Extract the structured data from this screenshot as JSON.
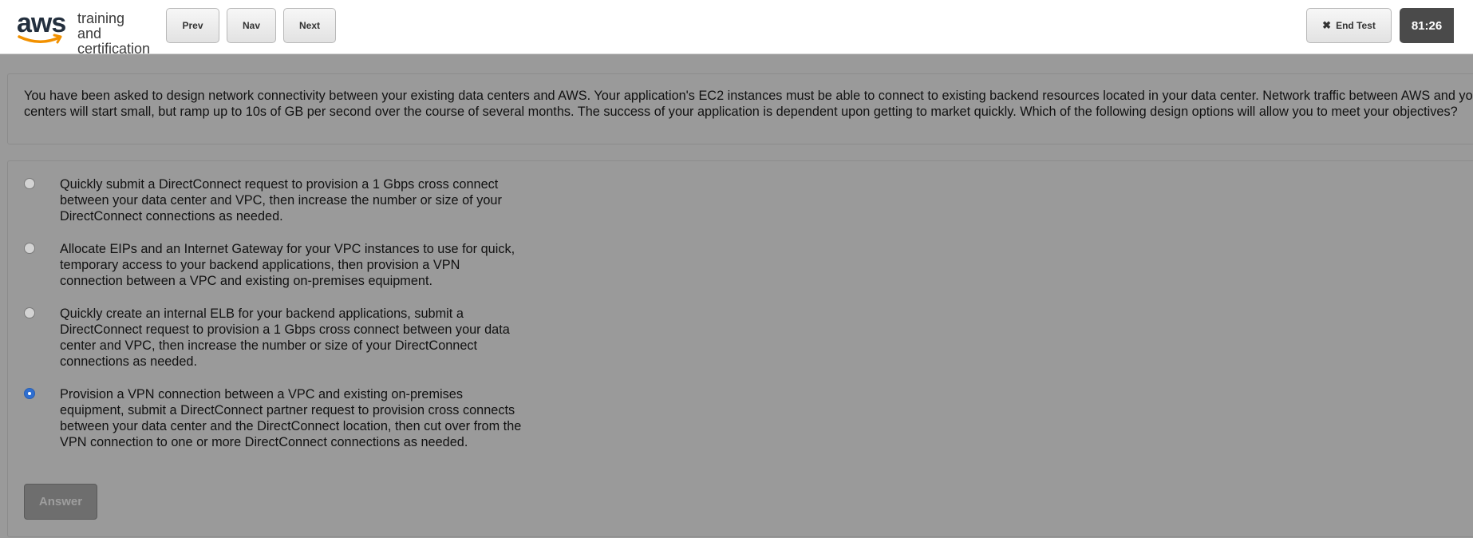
{
  "header": {
    "logo": {
      "brand": "aws",
      "subtitle_line1": "training and",
      "subtitle_line2": "certification"
    },
    "prev_label": "Prev",
    "nav_label": "Nav",
    "next_label": "Next",
    "end_test_label": "End Test",
    "timer": "81:26"
  },
  "question": {
    "text": "You have been asked to design network connectivity between your existing data centers and AWS. Your application's EC2 instances must be able to connect to existing backend resources located in your data center. Network traffic between AWS and your data centers will start small, but ramp up to 10s of GB per second over the course of several months. The success of your application is dependent upon getting to market quickly. Which of the following design options will allow you to meet your objectives?"
  },
  "options": [
    {
      "text": "Quickly submit a DirectConnect request to provision a 1 Gbps cross connect between your data center and VPC, then increase the number or size of your DirectConnect connections as needed.",
      "selected": false
    },
    {
      "text": "Allocate EIPs and an Internet Gateway for your VPC instances to use for quick, temporary access to your backend applications, then provision a VPN connection between a VPC and existing on-premises equipment.",
      "selected": false
    },
    {
      "text": "Quickly create an internal ELB for your backend applications, submit a DirectConnect request to provision a 1 Gbps cross connect between your data center and VPC, then increase the number or size of your DirectConnect connections as needed.",
      "selected": false
    },
    {
      "text": "Provision a VPN connection between a VPC and existing on-premises equipment, submit a DirectConnect partner request to provision cross connects between your data center and the DirectConnect location, then cut over from the VPN connection to one or more DirectConnect connections as needed.",
      "selected": true
    }
  ],
  "answer_button_label": "Answer",
  "colors": {
    "selected_radio": "#2f6fd1",
    "timer_bg": "#4a4a4a",
    "overlay": "#9a9a9a"
  }
}
